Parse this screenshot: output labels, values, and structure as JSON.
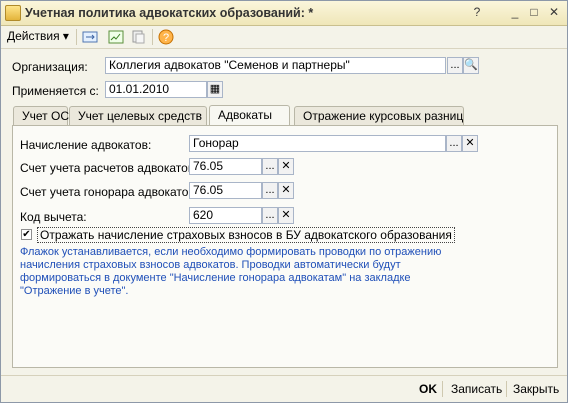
{
  "window": {
    "title": "Учетная политика адвокатских образований: *",
    "controls": {
      "help": "?",
      "minimize": "_",
      "maximize": "□",
      "close": "✕"
    }
  },
  "toolbar": {
    "actions_label": "Действия ▾",
    "icons": [
      "exchange-icon",
      "chart-icon",
      "copy-icon",
      "help-icon"
    ]
  },
  "header": {
    "org_label": "Организация:",
    "org_value": "Коллегия адвокатов \"Семенов и партнеры\"",
    "date_label": "Применяется с:",
    "date_value": "01.01.2010"
  },
  "tabs": [
    {
      "label": "Учет ОС"
    },
    {
      "label": "Учет целевых средств"
    },
    {
      "label": "Адвокаты",
      "active": true
    },
    {
      "label": "Отражение курсовых разниц"
    }
  ],
  "form": {
    "accrual_label": "Начисление адвокатов:",
    "accrual_value": "Гонорар",
    "account_settlement_label": "Счет учета расчетов адвокатов:",
    "account_settlement_value": "76.05",
    "account_fee_label": "Счет учета гонорара адвокатов:",
    "account_fee_value": "76.05",
    "deduction_label": "Код вычета:",
    "deduction_value": "620",
    "checkbox_label": "Отражать начисление страховых взносов в БУ адвокатского образования",
    "checkbox_checked": "✔",
    "note": [
      "Флажок устанавливается, если необходимо формировать проводки по отражению",
      "начисления страховых взносов адвокатов. Проводки автоматически будут",
      "формироваться в документе \"Начисление гонорара адвокатам\" на закладке",
      "\"Отражение в учете\"."
    ]
  },
  "footer": {
    "ok": "OK",
    "save": "Записать",
    "close": "Закрыть"
  },
  "glyphs": {
    "ellipsis": "...",
    "search": "🔍",
    "clear": "✕",
    "calendar": "▦"
  }
}
